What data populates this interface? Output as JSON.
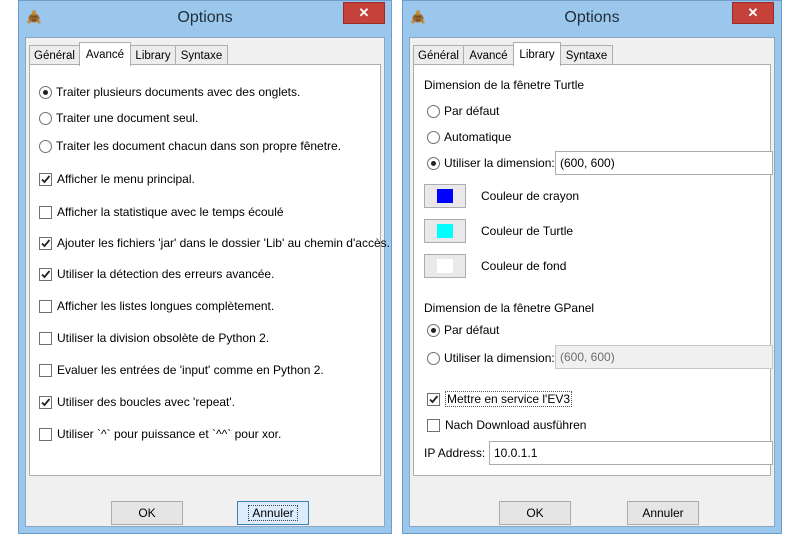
{
  "windows": {
    "left": {
      "title": "Options",
      "close_symbol": "✕",
      "tabs": [
        "Général",
        "Avancé",
        "Library",
        "Syntaxe"
      ],
      "active_tab": "Avancé",
      "radios": [
        {
          "label": "Traiter plusieurs documents avec des onglets.",
          "selected": true
        },
        {
          "label": "Traiter une document seul.",
          "selected": false
        },
        {
          "label": "Traiter les document chacun dans son propre fênetre.",
          "selected": false
        }
      ],
      "checkboxes": [
        {
          "label": "Afficher le menu principal.",
          "checked": true
        },
        {
          "label": "Afficher la statistique avec le temps écoulé",
          "checked": false
        },
        {
          "label": "Ajouter les fichiers 'jar' dans le dossier 'Lib' au chemin d'accès.",
          "checked": true
        },
        {
          "label": "Utiliser la détection des erreurs avancée.",
          "checked": true
        },
        {
          "label": "Afficher les listes longues complètement.",
          "checked": false
        },
        {
          "label": "Utiliser la division obsolète de Python 2.",
          "checked": false
        },
        {
          "label": "Evaluer les entrées de 'input' comme en Python 2.",
          "checked": false
        },
        {
          "label": "Utiliser des boucles avec 'repeat'.",
          "checked": true
        },
        {
          "label": "Utiliser `^` pour puissance et `^^` pour xor.",
          "checked": false
        }
      ],
      "ok_label": "OK",
      "cancel_label": "Annuler"
    },
    "right": {
      "title": "Options",
      "close_symbol": "✕",
      "tabs": [
        "Général",
        "Avancé",
        "Library",
        "Syntaxe"
      ],
      "active_tab": "Library",
      "turtle": {
        "section_title": "Dimension de la fênetre Turtle",
        "radio_default": "Par défaut",
        "radio_auto": "Automatique",
        "radio_custom": "Utiliser la dimension:",
        "selected": "custom",
        "dimension_value": "(600, 600)",
        "pen_color_label": "Couleur de crayon",
        "turtle_color_label": "Couleur de Turtle",
        "background_color_label": "Couleur de fond",
        "pen_color": "#0000ff",
        "turtle_color": "#00ffff",
        "background_color": "#ffffff"
      },
      "gpanel": {
        "section_title": "Dimension de la fênetre GPanel",
        "radio_default": "Par défaut",
        "radio_custom": "Utiliser la dimension:",
        "selected": "default",
        "dimension_value": "(600, 600)"
      },
      "ev3_label": "Mettre en service l'EV3",
      "ev3_checked": true,
      "download_label": "Nach Download ausführen",
      "download_checked": false,
      "ip_label": "IP Address:",
      "ip_value": "10.0.1.1",
      "ok_label": "OK",
      "cancel_label": "Annuler"
    }
  },
  "colors": {
    "titlebar": "#9cc7ec",
    "close_button": "#c7413b",
    "client_bg": "#f0f0f0"
  }
}
